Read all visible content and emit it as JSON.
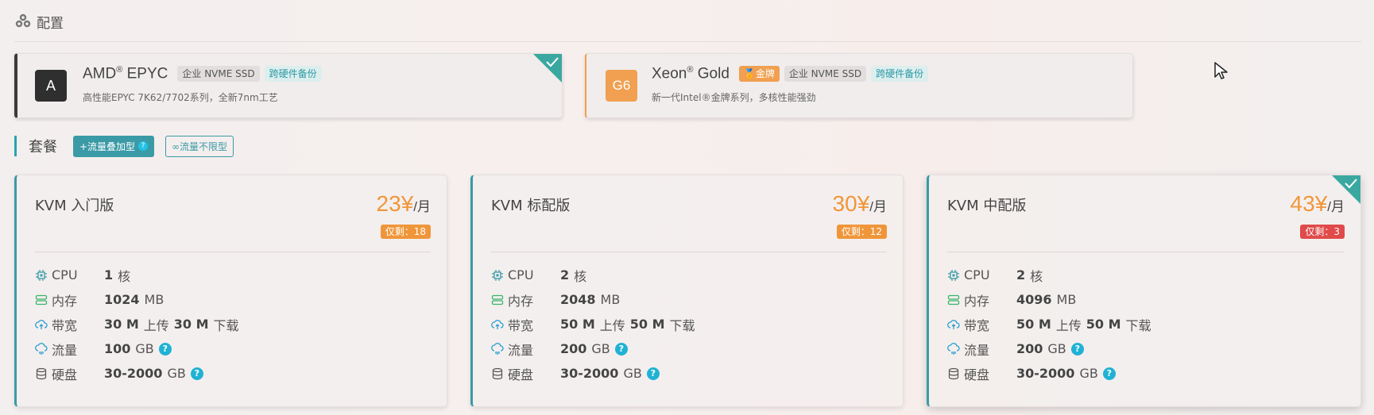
{
  "config": {
    "title": "配置",
    "cards": [
      {
        "logo": "A",
        "name": "AMD",
        "name_sup": "®",
        "name_suffix": " EPYC",
        "tags": [
          "企业 NVME SSD",
          "跨硬件备份"
        ],
        "desc": "高性能EPYC 7K62/7702系列，全新7nm工艺",
        "selected": true
      },
      {
        "logo": "G6",
        "name": "Xeon",
        "name_sup": "®",
        "name_suffix": " Gold",
        "badge": "🏅金牌",
        "tags": [
          "企业 NVME SSD",
          "跨硬件备份"
        ],
        "desc": "新一代Intel®金牌系列，多核性能强劲",
        "selected": false
      }
    ]
  },
  "plans": {
    "title": "套餐",
    "btn_traffic_addon": "+流量叠加型",
    "btn_unlimited": "∞流量不限型",
    "spec_labels": {
      "cpu": "CPU",
      "mem": "内存",
      "bw": "带宽",
      "traffic": "流量",
      "disk": "硬盘"
    },
    "items": [
      {
        "name": "KVM 入门版",
        "price": "23¥",
        "unit": "/月",
        "stock": "仅剩：18",
        "stock_color": "#f0963a",
        "cpu": "1",
        "cpu_unit": "核",
        "mem": "1024",
        "mem_unit": "MB",
        "bw_up": "30 M",
        "bw_up_label": "上传",
        "bw_down": "30 M",
        "bw_down_label": "下载",
        "traffic": "100",
        "traffic_unit": "GB",
        "disk": "30-2000",
        "disk_unit": "GB",
        "selected": false
      },
      {
        "name": "KVM 标配版",
        "price": "30¥",
        "unit": "/月",
        "stock": "仅剩：12",
        "stock_color": "#f0963a",
        "cpu": "2",
        "cpu_unit": "核",
        "mem": "2048",
        "mem_unit": "MB",
        "bw_up": "50 M",
        "bw_up_label": "上传",
        "bw_down": "50 M",
        "bw_down_label": "下载",
        "traffic": "200",
        "traffic_unit": "GB",
        "disk": "30-2000",
        "disk_unit": "GB",
        "selected": false
      },
      {
        "name": "KVM 中配版",
        "price": "43¥",
        "unit": "/月",
        "stock": "仅剩：3",
        "stock_color": "#e04a4a",
        "cpu": "2",
        "cpu_unit": "核",
        "mem": "4096",
        "mem_unit": "MB",
        "bw_up": "50 M",
        "bw_up_label": "上传",
        "bw_down": "50 M",
        "bw_down_label": "下载",
        "traffic": "200",
        "traffic_unit": "GB",
        "disk": "30-2000",
        "disk_unit": "GB",
        "selected": true
      }
    ]
  },
  "help_glyph": "?",
  "colors": {
    "accent": "#3a9aa6",
    "price": "#f0963a",
    "stock_low": "#e04a4a",
    "check": "#3aa8a0"
  }
}
